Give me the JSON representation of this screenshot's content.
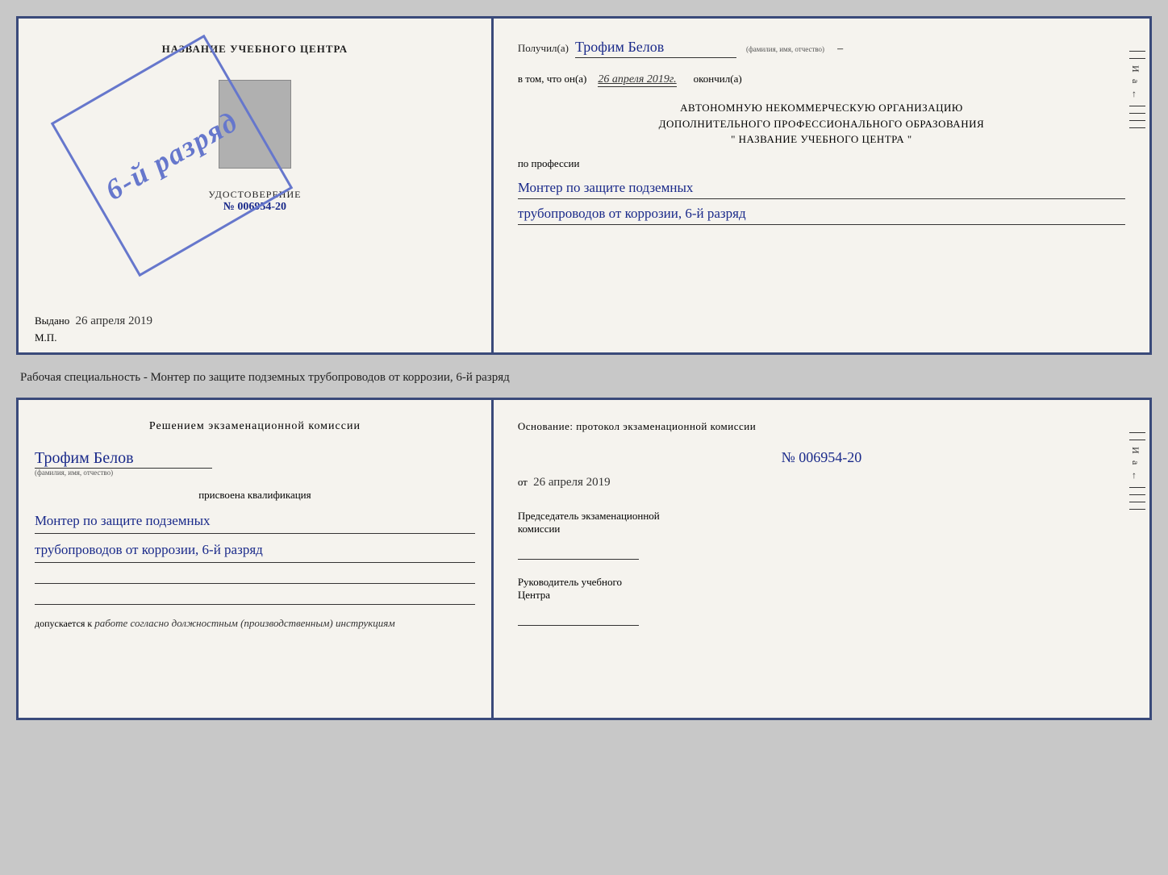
{
  "top_cert": {
    "left": {
      "title": "НАЗВАНИЕ УЧЕБНОГО ЦЕНТРА",
      "stamp_text": "6-й разряд",
      "udostoverenie_label": "УДОСТОВЕРЕНИЕ",
      "number": "№ 006954-20",
      "vydano_label": "Выдано",
      "vydano_date": "26 апреля 2019",
      "mp_label": "М.П."
    },
    "right": {
      "poluchil_label": "Получил(a)",
      "name": "Трофим Белов",
      "name_small": "(фамилия, имя, отчество)",
      "dash": "–",
      "vtom_label": "в том, что он(а)",
      "date": "26 апреля 2019г.",
      "okonchil_label": "окончил(а)",
      "org_line1": "АВТОНОМНУЮ НЕКОММЕРЧЕСКУЮ ОРГАНИЗАЦИЮ",
      "org_line2": "ДОПОЛНИТЕЛЬНОГО ПРОФЕССИОНАЛЬНОГО ОБРАЗОВАНИЯ",
      "org_line3": "\" НАЗВАНИЕ УЧЕБНОГО ЦЕНТРА \"",
      "po_professii": "по профессии",
      "profession_line1": "Монтер по защите подземных",
      "profession_line2": "трубопроводов от коррозии, 6-й разряд"
    }
  },
  "specialist_text": "Рабочая специальность - Монтер по защите подземных трубопроводов от коррозии, 6-й разряд",
  "bottom_cert": {
    "left": {
      "resheniem_label": "Решением экзаменационной комиссии",
      "name": "Трофим Белов",
      "name_small": "(фамилия, имя, отчество)",
      "prisvoena_label": "присвоена квалификация",
      "qualification_line1": "Монтер по защите подземных",
      "qualification_line2": "трубопроводов от коррозии, 6-й разряд",
      "dopuskaetsya_label": "допускается к",
      "dopuskaetsya_text": "работе согласно должностным (производственным) инструкциям"
    },
    "right": {
      "osnovanie_label": "Основание: протокол экзаменационной комиссии",
      "number": "№ 006954-20",
      "ot_label": "от",
      "ot_date": "26 апреля 2019",
      "chairman_line1": "Председатель экзаменационной",
      "chairman_line2": "комиссии",
      "rukovoditel_line1": "Руководитель учебного",
      "rukovoditel_line2": "Центра"
    }
  },
  "side_marks": {
    "i": "И",
    "a": "а",
    "arrow": "←"
  }
}
